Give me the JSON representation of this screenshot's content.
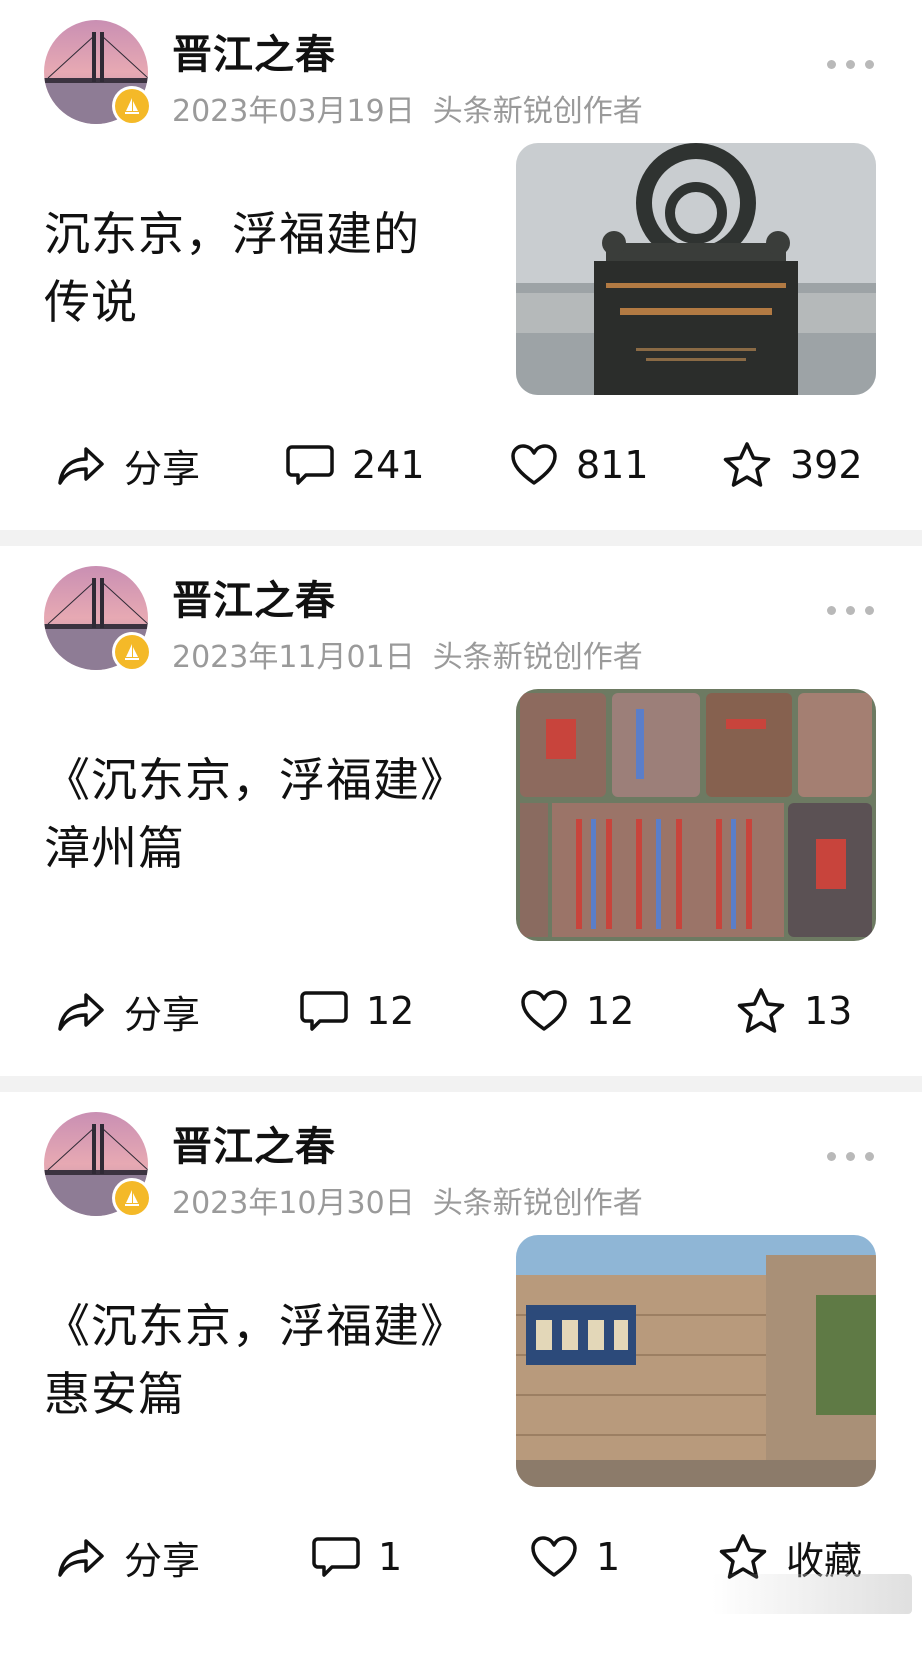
{
  "posts": [
    {
      "author": "晋江之春",
      "date": "2023年03月19日",
      "role": "头条新锐创作者",
      "title_line1": "沉东京，浮福建的",
      "title_line2": "传说",
      "share_label": "分享",
      "comments": "241",
      "likes": "811",
      "last_action": "392"
    },
    {
      "author": "晋江之春",
      "date": "2023年11月01日",
      "role": "头条新锐创作者",
      "title_line1": "《沉东京，浮福建》",
      "title_line2": "漳州篇",
      "share_label": "分享",
      "comments": "12",
      "likes": "12",
      "last_action": "13"
    },
    {
      "author": "晋江之春",
      "date": "2023年10月30日",
      "role": "头条新锐创作者",
      "title_line1": "《沉东京，浮福建》",
      "title_line2": "惠安篇",
      "share_label": "分享",
      "comments": "1",
      "likes": "1",
      "last_action": "收藏"
    }
  ],
  "icons": {
    "share": "share-arrow-icon",
    "comment": "comment-bubble-icon",
    "like": "heart-icon",
    "favorite": "star-icon",
    "more": "more-dots-icon",
    "badge": "sail-badge-icon"
  },
  "colors": {
    "badge": "#f4b928",
    "meta_text": "#9a9a9a",
    "separator": "#f2f2f2"
  }
}
